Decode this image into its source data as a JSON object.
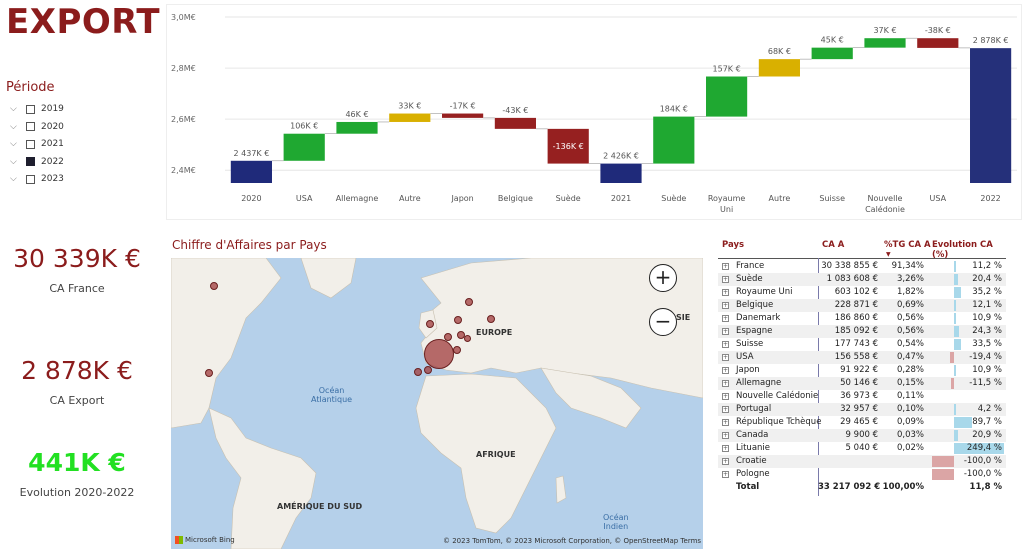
{
  "title": "EXPORT",
  "period": {
    "label": "Période",
    "items": [
      {
        "year": "2019",
        "checked": false
      },
      {
        "year": "2020",
        "checked": false
      },
      {
        "year": "2021",
        "checked": false
      },
      {
        "year": "2022",
        "checked": true
      },
      {
        "year": "2023",
        "checked": false
      }
    ]
  },
  "kpis": [
    {
      "value": "30 339K €",
      "label": "CA France",
      "color": "#8b1c1c"
    },
    {
      "value": "2 878K €",
      "label": "CA Export",
      "color": "#8b1c1c"
    },
    {
      "value": "441K €",
      "label": "Evolution 2020-2022",
      "color": "#22e022"
    }
  ],
  "chart_data": {
    "type": "waterfall",
    "ylim": [
      2.35,
      3.0
    ],
    "yticks": [
      {
        "value": 2.4,
        "label": "2,4M€"
      },
      {
        "value": 2.6,
        "label": "2,6M€"
      },
      {
        "value": 2.8,
        "label": "2,8M€"
      },
      {
        "value": 3.0,
        "label": "3,0M€"
      }
    ],
    "bars": [
      {
        "category": "2020",
        "start": 0,
        "end": 2.437,
        "label": "2 437K €",
        "kind": "total"
      },
      {
        "category": "USA",
        "start": 2.437,
        "end": 2.543,
        "label": "106K €",
        "kind": "up"
      },
      {
        "category": "Allemagne",
        "start": 2.543,
        "end": 2.589,
        "label": "46K €",
        "kind": "up"
      },
      {
        "category": "Autre",
        "start": 2.589,
        "end": 2.622,
        "label": "33K €",
        "kind": "other"
      },
      {
        "category": "Japon",
        "start": 2.622,
        "end": 2.605,
        "label": "-17K €",
        "kind": "down"
      },
      {
        "category": "Belgique",
        "start": 2.605,
        "end": 2.562,
        "label": "-43K €",
        "kind": "down"
      },
      {
        "category": "Suède",
        "start": 2.562,
        "end": 2.426,
        "label": "-136K €",
        "kind": "down"
      },
      {
        "category": "2021",
        "start": 0,
        "end": 2.426,
        "label": "2 426K €",
        "kind": "total"
      },
      {
        "category": "Suède",
        "start": 2.426,
        "end": 2.61,
        "label": "184K €",
        "kind": "up"
      },
      {
        "category": "Royaume Uni",
        "start": 2.61,
        "end": 2.767,
        "label": "157K €",
        "kind": "up"
      },
      {
        "category": "Autre",
        "start": 2.767,
        "end": 2.835,
        "label": "68K €",
        "kind": "other"
      },
      {
        "category": "Suisse",
        "start": 2.835,
        "end": 2.88,
        "label": "45K €",
        "kind": "up"
      },
      {
        "category": "Nouvelle Calédonie",
        "start": 2.88,
        "end": 2.917,
        "label": "37K €",
        "kind": "up"
      },
      {
        "category": "USA",
        "start": 2.917,
        "end": 2.879,
        "label": "-38K €",
        "kind": "down"
      },
      {
        "category": "2022",
        "start": 0,
        "end": 2.878,
        "label": "2 878K €",
        "kind": "total2022"
      }
    ],
    "colors": {
      "up": "#1fa831",
      "down": "#962020",
      "other": "#d9b000",
      "total": "#1f2a7a",
      "total2022": "#25307a"
    }
  },
  "map": {
    "title": "Chiffre d'Affaires par Pays",
    "labels": {
      "europe": "EUROPE",
      "afrique": "AFRIQUE",
      "amsud": "AMÉRIQUE DU SUD",
      "asie": "SIE"
    },
    "oceans": {
      "atlantique": "Océan\nAtlantique",
      "indien": "Océan\nIndien"
    },
    "zoom_in": "+",
    "zoom_out": "−",
    "footer": "© 2023 TomTom, © 2023 Microsoft Corporation, © OpenStreetMap  Terms",
    "brand": "Microsoft Bing"
  },
  "table": {
    "headers": {
      "pays": "Pays",
      "ca": "CA A",
      "pct": "%TG CA A",
      "evo": "Evolution CA (%)"
    },
    "rows": [
      {
        "pays": "France",
        "ca": "30 338 855 €",
        "pct": "91,34%",
        "evo": "11,2 %",
        "evo_value": 11.2
      },
      {
        "pays": "Suède",
        "ca": "1 083 608 €",
        "pct": "3,26%",
        "evo": "20,4 %",
        "evo_value": 20.4
      },
      {
        "pays": "Royaume Uni",
        "ca": "603 102 €",
        "pct": "1,82%",
        "evo": "35,2 %",
        "evo_value": 35.2
      },
      {
        "pays": "Belgique",
        "ca": "228 871 €",
        "pct": "0,69%",
        "evo": "12,1 %",
        "evo_value": 12.1
      },
      {
        "pays": "Danemark",
        "ca": "186 860 €",
        "pct": "0,56%",
        "evo": "10,9 %",
        "evo_value": 10.9
      },
      {
        "pays": "Espagne",
        "ca": "185 092 €",
        "pct": "0,56%",
        "evo": "24,3 %",
        "evo_value": 24.3
      },
      {
        "pays": "Suisse",
        "ca": "177 743 €",
        "pct": "0,54%",
        "evo": "33,5 %",
        "evo_value": 33.5
      },
      {
        "pays": "USA",
        "ca": "156 558 €",
        "pct": "0,47%",
        "evo": "-19,4 %",
        "evo_value": -19.4
      },
      {
        "pays": "Japon",
        "ca": "91 922 €",
        "pct": "0,28%",
        "evo": "10,9 %",
        "evo_value": 10.9
      },
      {
        "pays": "Allemagne",
        "ca": "50 146 €",
        "pct": "0,15%",
        "evo": "-11,5 %",
        "evo_value": -11.5
      },
      {
        "pays": "Nouvelle Calédonie",
        "ca": "36 973 €",
        "pct": "0,11%",
        "evo": "",
        "evo_value": 0
      },
      {
        "pays": "Portugal",
        "ca": "32 957 €",
        "pct": "0,10%",
        "evo": "4,2 %",
        "evo_value": 4.2
      },
      {
        "pays": "République Tchèque",
        "ca": "29 465 €",
        "pct": "0,09%",
        "evo": "89,7 %",
        "evo_value": 89.7
      },
      {
        "pays": "Canada",
        "ca": "9 900 €",
        "pct": "0,03%",
        "evo": "20,9 %",
        "evo_value": 20.9
      },
      {
        "pays": "Lituanie",
        "ca": "5 040 €",
        "pct": "0,02%",
        "evo": "249,4 %",
        "evo_value": 249.4
      },
      {
        "pays": "Croatie",
        "ca": "",
        "pct": "",
        "evo": "-100,0 %",
        "evo_value": -100
      },
      {
        "pays": "Pologne",
        "ca": "",
        "pct": "",
        "evo": "-100,0 %",
        "evo_value": -100
      }
    ],
    "total": {
      "pays": "Total",
      "ca": "33 217 092 €",
      "pct": "100,00%",
      "evo": "11,8 %"
    },
    "colors": {
      "pos": "#a8d8ea",
      "neg": "#dba5a5"
    }
  }
}
